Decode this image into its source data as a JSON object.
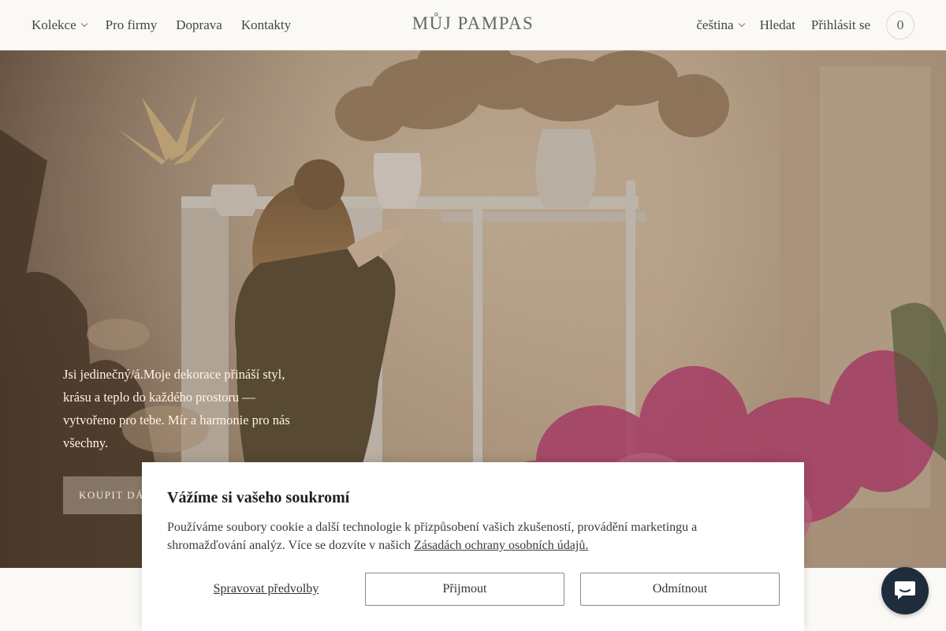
{
  "header": {
    "nav_left": [
      {
        "label": "Kolekce",
        "has_dropdown": true
      },
      {
        "label": "Pro firmy"
      },
      {
        "label": "Doprava"
      },
      {
        "label": "Kontakty"
      }
    ],
    "logo": "MŮJ PAMPAS",
    "language": "čeština",
    "search": "Hledat",
    "login": "Přihlásit se",
    "cart_count": "0"
  },
  "hero": {
    "text": "Jsi jedinečný/á.Moje dekorace přináší styl, krásu a teplo do každého prostoru — vytvořeno pro tebe. Mír a harmonie pro nás všechny.",
    "button": "KOUPIT DÁR"
  },
  "cookie": {
    "title": "Vážíme si vašeho soukromí",
    "text": "Používáme soubory cookie a další technologie k přizpůsobení vašich zkušeností, provádění marketingu a shromažďování analýz. Více se dozvíte v našich ",
    "link": "Zásadách ochrany osobních údajů.",
    "manage": "Spravovat předvolby",
    "accept": "Přijmout",
    "decline": "Odmítnout"
  },
  "chat": {
    "icon": "chat-bubble-icon"
  }
}
